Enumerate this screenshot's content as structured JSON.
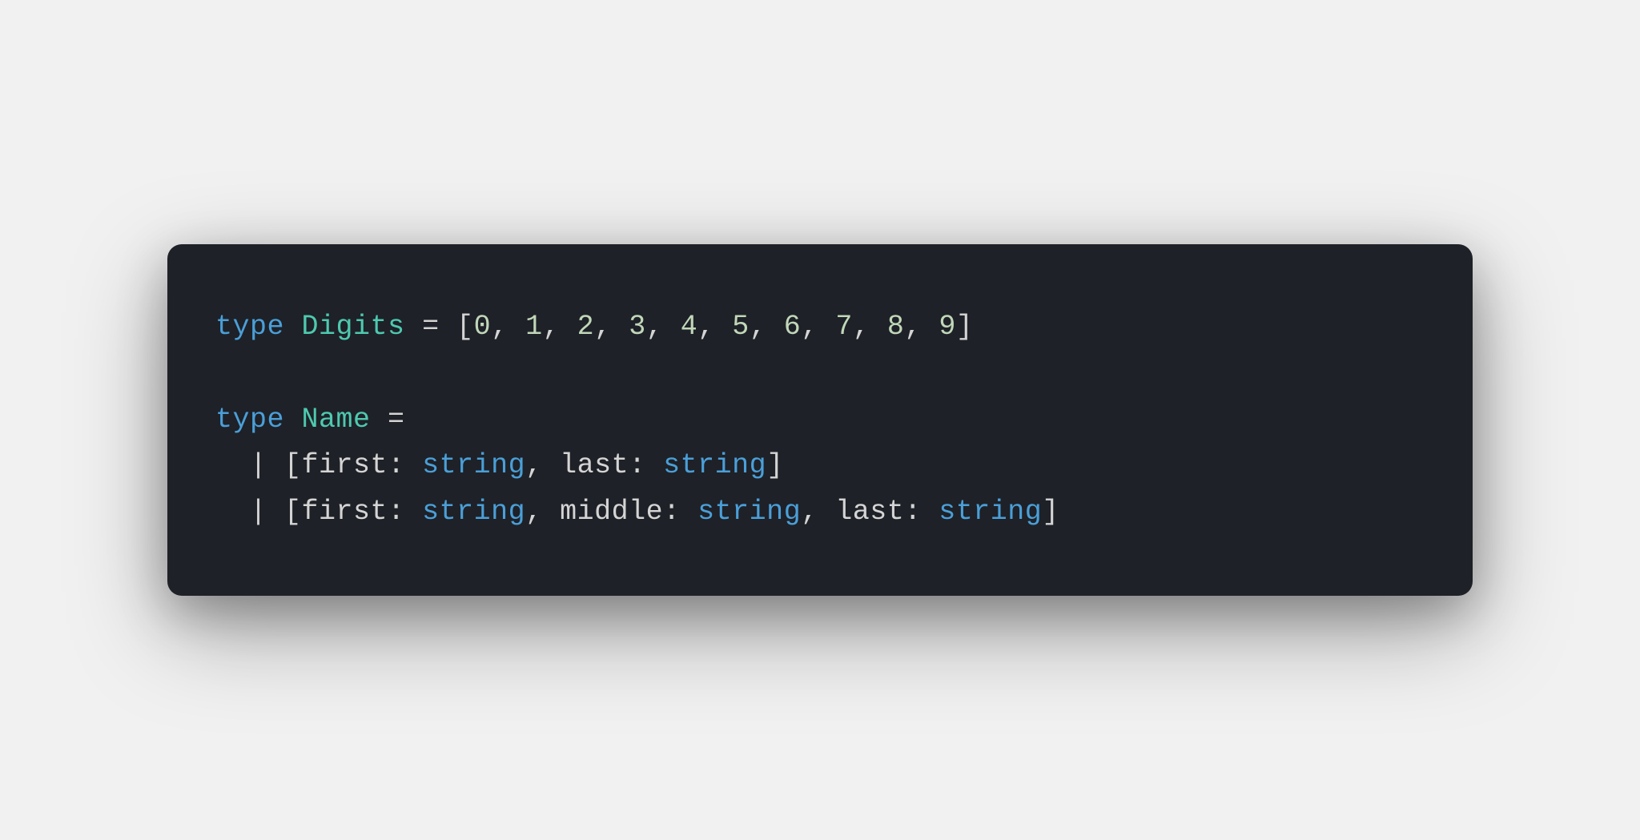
{
  "colors": {
    "background_page": "#f1f1f1",
    "background_code": "#1e2127",
    "keyword": "#4a9fd8",
    "type_name": "#4ec9b0",
    "number": "#c1d7b9",
    "default_text": "#d4d4d4",
    "builtin_type": "#4a9fd8"
  },
  "code": {
    "line1": {
      "kw": "type",
      "name": "Digits",
      "eq": " = ",
      "open": "[",
      "d0": "0",
      "c0": ", ",
      "d1": "1",
      "c1": ", ",
      "d2": "2",
      "c2": ", ",
      "d3": "3",
      "c3": ", ",
      "d4": "4",
      "c4": ", ",
      "d5": "5",
      "c5": ", ",
      "d6": "6",
      "c6": ", ",
      "d7": "7",
      "c7": ", ",
      "d8": "8",
      "c8": ", ",
      "d9": "9",
      "close": "]"
    },
    "line3": {
      "kw": "type",
      "name": "Name",
      "eq": " ="
    },
    "line4": {
      "indent": "  | [",
      "l1": "first",
      "s1": ": ",
      "t1": "string",
      "c1": ", ",
      "l2": "last",
      "s2": ": ",
      "t2": "string",
      "close": "]"
    },
    "line5": {
      "indent": "  | [",
      "l1": "first",
      "s1": ": ",
      "t1": "string",
      "c1": ", ",
      "l2": "middle",
      "s2": ": ",
      "t2": "string",
      "c2": ", ",
      "l3": "last",
      "s3": ": ",
      "t3": "string",
      "close": "]"
    }
  }
}
